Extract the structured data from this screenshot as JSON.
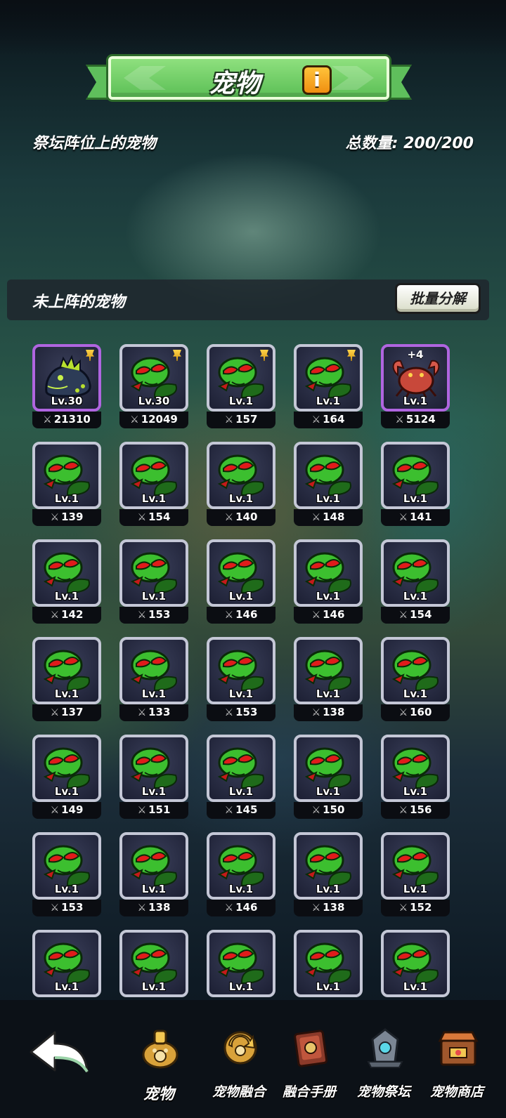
{
  "header": {
    "title": "宠物",
    "info_icon_label": "i"
  },
  "altar": {
    "label": "祭坛阵位上的宠物",
    "total": "总数量: 200/200"
  },
  "unassigned": {
    "label": "未上阵的宠物",
    "batch_button": "批量分解"
  },
  "pets": [
    {
      "level": "Lv.30",
      "power": "21310",
      "type": "dragon",
      "pinned": true,
      "rarity": "rare"
    },
    {
      "level": "Lv.30",
      "power": "12049",
      "type": "plant",
      "pinned": true
    },
    {
      "level": "Lv.1",
      "power": "157",
      "type": "plant",
      "pinned": true
    },
    {
      "level": "Lv.1",
      "power": "164",
      "type": "plant",
      "pinned": true
    },
    {
      "level": "Lv.1",
      "power": "5124",
      "type": "crab",
      "plus": "+4",
      "rarity": "rare"
    },
    {
      "level": "Lv.1",
      "power": "139",
      "type": "plant"
    },
    {
      "level": "Lv.1",
      "power": "154",
      "type": "plant"
    },
    {
      "level": "Lv.1",
      "power": "140",
      "type": "plant"
    },
    {
      "level": "Lv.1",
      "power": "148",
      "type": "plant"
    },
    {
      "level": "Lv.1",
      "power": "141",
      "type": "plant"
    },
    {
      "level": "Lv.1",
      "power": "142",
      "type": "plant"
    },
    {
      "level": "Lv.1",
      "power": "153",
      "type": "plant"
    },
    {
      "level": "Lv.1",
      "power": "146",
      "type": "plant"
    },
    {
      "level": "Lv.1",
      "power": "146",
      "type": "plant"
    },
    {
      "level": "Lv.1",
      "power": "154",
      "type": "plant"
    },
    {
      "level": "Lv.1",
      "power": "137",
      "type": "plant"
    },
    {
      "level": "Lv.1",
      "power": "133",
      "type": "plant"
    },
    {
      "level": "Lv.1",
      "power": "153",
      "type": "plant"
    },
    {
      "level": "Lv.1",
      "power": "138",
      "type": "plant"
    },
    {
      "level": "Lv.1",
      "power": "160",
      "type": "plant"
    },
    {
      "level": "Lv.1",
      "power": "149",
      "type": "plant"
    },
    {
      "level": "Lv.1",
      "power": "151",
      "type": "plant"
    },
    {
      "level": "Lv.1",
      "power": "145",
      "type": "plant"
    },
    {
      "level": "Lv.1",
      "power": "150",
      "type": "plant"
    },
    {
      "level": "Lv.1",
      "power": "156",
      "type": "plant"
    },
    {
      "level": "Lv.1",
      "power": "153",
      "type": "plant"
    },
    {
      "level": "Lv.1",
      "power": "138",
      "type": "plant"
    },
    {
      "level": "Lv.1",
      "power": "146",
      "type": "plant"
    },
    {
      "level": "Lv.1",
      "power": "138",
      "type": "plant"
    },
    {
      "level": "Lv.1",
      "power": "152",
      "type": "plant"
    },
    {
      "level": "Lv.1",
      "power": "",
      "type": "plant"
    },
    {
      "level": "Lv.1",
      "power": "",
      "type": "plant"
    },
    {
      "level": "Lv.1",
      "power": "",
      "type": "plant"
    },
    {
      "level": "Lv.1",
      "power": "",
      "type": "plant"
    },
    {
      "level": "Lv.1",
      "power": "",
      "type": "plant"
    }
  ],
  "nav": {
    "back_icon": "back-arrow-icon",
    "items": [
      {
        "label": "宠物",
        "icon": "pet-bell-icon",
        "active": true
      },
      {
        "label": "宠物融合",
        "icon": "fusion-icon"
      },
      {
        "label": "融合手册",
        "icon": "handbook-icon"
      },
      {
        "label": "宠物祭坛",
        "icon": "altar-icon"
      },
      {
        "label": "宠物商店",
        "icon": "shop-icon"
      }
    ]
  },
  "colors": {
    "banner_green": "#6fce66",
    "rare_border": "#b065e0",
    "normal_border": "#c4c7d6",
    "info_orange": "#f5a623"
  }
}
